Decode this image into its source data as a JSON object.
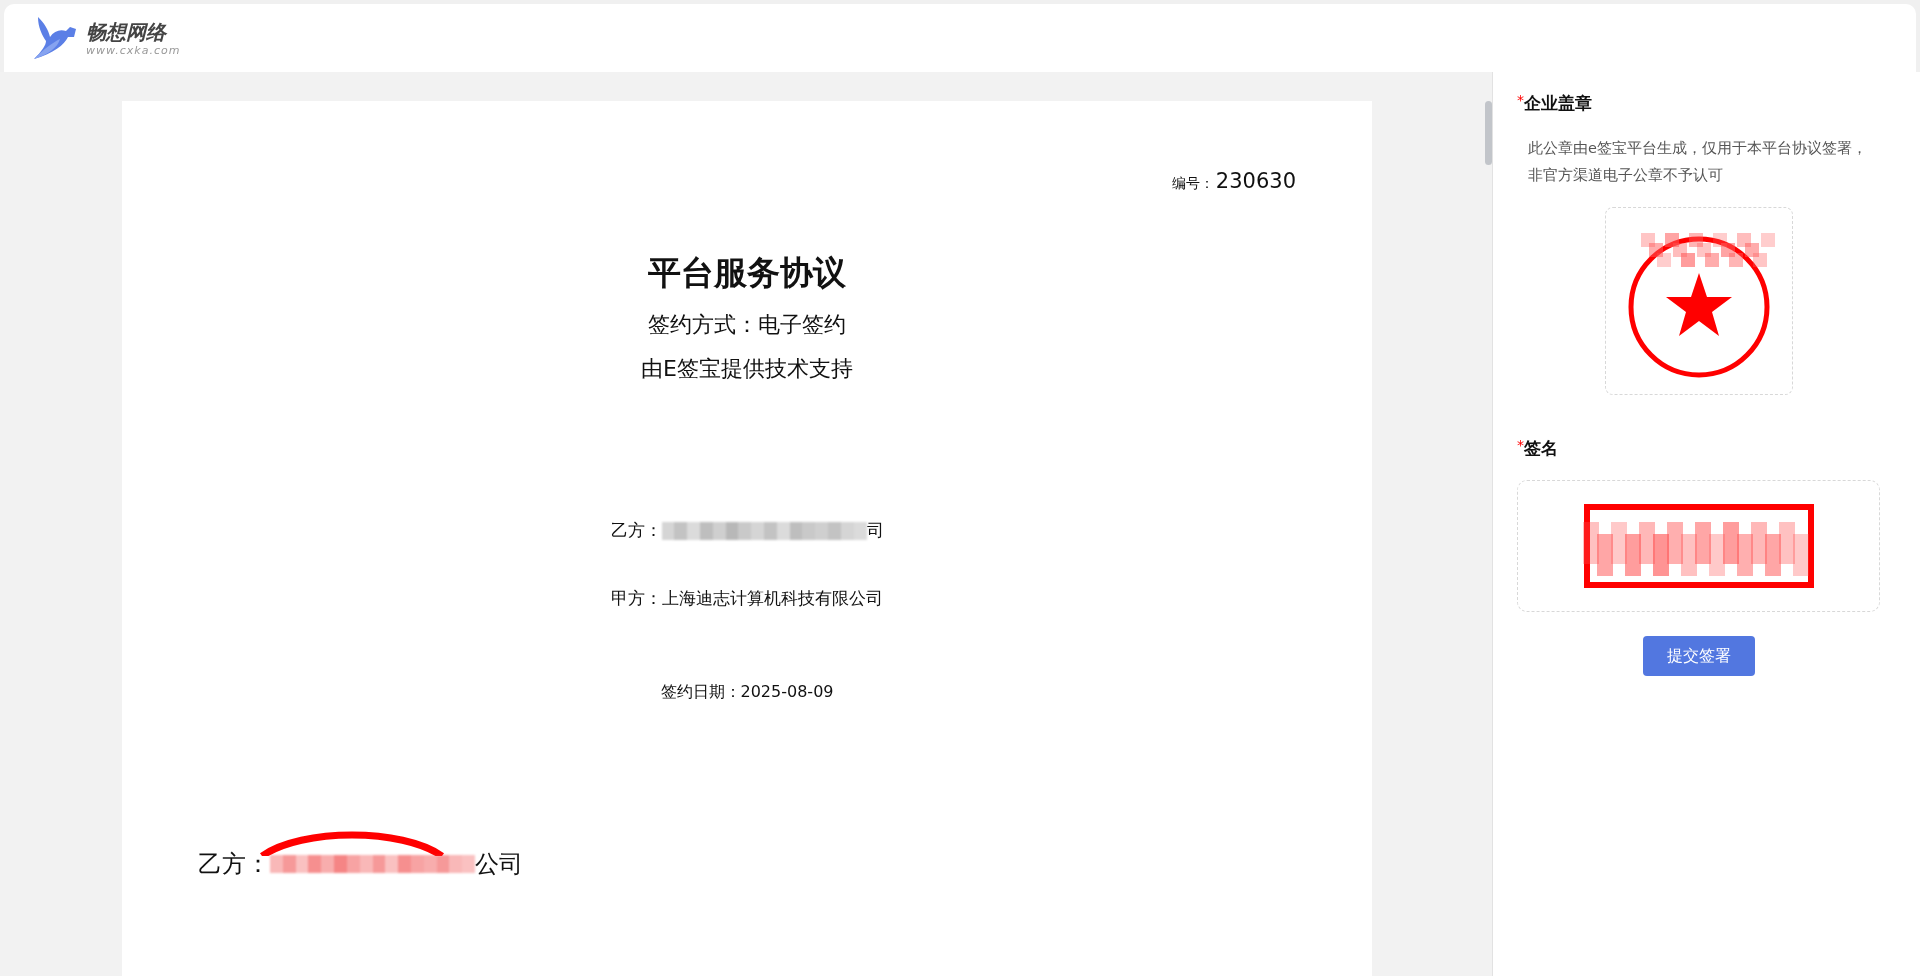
{
  "header": {
    "logo_name": "畅想网络",
    "logo_url": "www.cxka.com"
  },
  "document": {
    "number_label": "编号：",
    "number": "230630",
    "title": "平台服务协议",
    "sign_method": "签约方式：电子签约",
    "provider": "由E签宝提供技术支持",
    "party_b": {
      "label": "乙方：",
      "tail": "司"
    },
    "party_a": "甲方：上海迪志计算机科技有限公司",
    "sign_date": "签约日期：2025-08-09",
    "footer_party": {
      "label": "乙方：",
      "tail": "公司"
    }
  },
  "panel": {
    "seal": {
      "required_mark": "*",
      "title": "企业盖章",
      "note": "此公章由e签宝平台生成，仅用于本平台协议签署，非官方渠道电子公章不予认可"
    },
    "signature": {
      "required_mark": "*",
      "title": "签名"
    },
    "submit": "提交签署"
  }
}
